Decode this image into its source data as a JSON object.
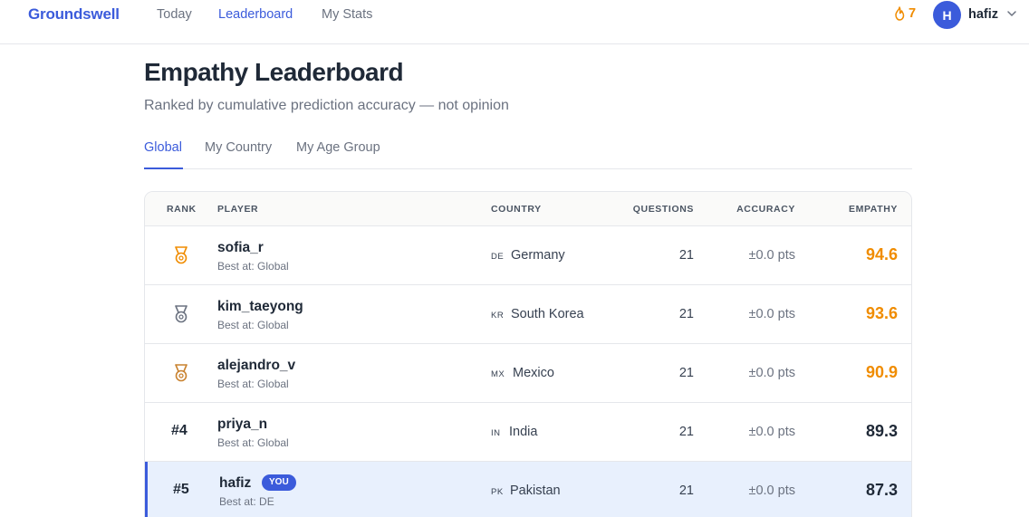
{
  "nav": {
    "brand": "Groundswell",
    "links": [
      "Today",
      "Leaderboard",
      "My Stats"
    ],
    "active": "Leaderboard",
    "streak": "7",
    "avatar_initial": "H",
    "username": "hafiz"
  },
  "page": {
    "title": "Empathy Leaderboard",
    "subtitle": "Ranked by cumulative prediction accuracy — not opinion"
  },
  "tabs": [
    "Global",
    "My Country",
    "My Age Group"
  ],
  "table": {
    "headers": {
      "rank": "RANK",
      "player": "PLAYER",
      "country": "COUNTRY",
      "questions": "QUESTIONS",
      "accuracy": "ACCURACY",
      "empathy": "EMPATHY"
    },
    "rows": [
      {
        "rank": "",
        "medal": "gold-medal-icon",
        "name": "sofia_r",
        "best_at": "Best at: Global",
        "cc": "DE",
        "country": "Germany",
        "questions": "21",
        "accuracy": "±0.0 pts",
        "empathy": "94.6",
        "empathy_color": "#f08c00",
        "you": ""
      },
      {
        "rank": "",
        "medal": "silver-medal-icon",
        "name": "kim_taeyong",
        "best_at": "Best at: Global",
        "cc": "KR",
        "country": "South Korea",
        "questions": "21",
        "accuracy": "±0.0 pts",
        "empathy": "93.6",
        "empathy_color": "#f08c00",
        "you": ""
      },
      {
        "rank": "",
        "medal": "bronze-medal-icon",
        "name": "alejandro_v",
        "best_at": "Best at: Global",
        "cc": "MX",
        "country": "Mexico",
        "questions": "21",
        "accuracy": "±0.0 pts",
        "empathy": "90.9",
        "empathy_color": "#f08c00",
        "you": ""
      },
      {
        "rank": "#4",
        "medal": "",
        "name": "priya_n",
        "best_at": "Best at: Global",
        "cc": "IN",
        "country": "India",
        "questions": "21",
        "accuracy": "±0.0 pts",
        "empathy": "89.3",
        "empathy_color": "#1f2937",
        "you": ""
      },
      {
        "rank": "#5",
        "medal": "",
        "name": "hafiz",
        "best_at": "Best at: DE",
        "cc": "PK",
        "country": "Pakistan",
        "questions": "21",
        "accuracy": "±0.0 pts",
        "empathy": "87.3",
        "empathy_color": "#1f2937",
        "you": "YOU"
      }
    ]
  },
  "colors": {
    "accent": "#3b5bdb",
    "gold": "#f08c00",
    "silver": "#6b7280",
    "bronze": "#c9822f"
  }
}
